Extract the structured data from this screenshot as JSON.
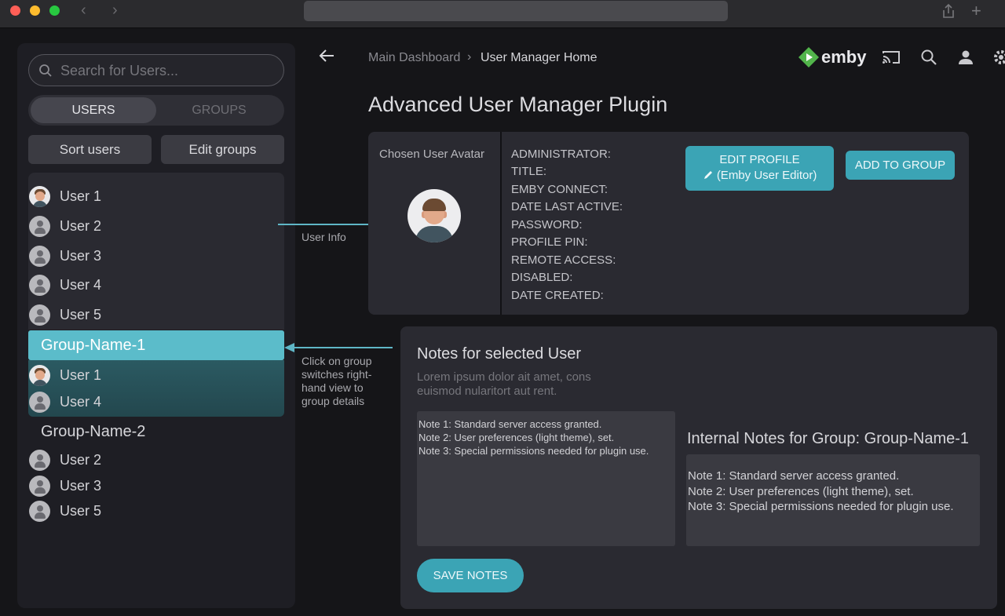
{
  "sidebar": {
    "search_placeholder": "Search for Users...",
    "tabs": [
      {
        "label": "USERS",
        "active": true
      },
      {
        "label": "GROUPS",
        "active": false
      }
    ],
    "sort_label": "Sort users",
    "edit_groups_label": "Edit groups",
    "users": [
      {
        "label": "User 1",
        "avatar": "photo"
      },
      {
        "label": "User 2",
        "avatar": "generic"
      },
      {
        "label": "User 3",
        "avatar": "generic"
      },
      {
        "label": "User 4",
        "avatar": "generic"
      },
      {
        "label": "User 5",
        "avatar": "generic"
      }
    ],
    "groups": [
      {
        "name": "Group-Name-1",
        "selected": true,
        "members": [
          {
            "label": "User 1",
            "avatar": "photo"
          },
          {
            "label": "User 4",
            "avatar": "generic"
          }
        ]
      },
      {
        "name": "Group-Name-2",
        "selected": false,
        "members": [
          {
            "label": "User 2",
            "avatar": "generic"
          },
          {
            "label": "User 3",
            "avatar": "generic"
          },
          {
            "label": "User 5",
            "avatar": "generic"
          }
        ]
      }
    ]
  },
  "annotations": {
    "user_info": "User Info",
    "group_click": [
      "Click on group",
      "switches right-",
      "hand view to",
      "group details"
    ]
  },
  "header": {
    "breadcrumb": [
      "Main Dashboard",
      "User Manager Home"
    ],
    "breadcrumb_sep": "›",
    "brand": "emby",
    "icons": [
      "back-arrow-icon",
      "cast-icon",
      "search-icon",
      "user-icon",
      "gear-icon"
    ]
  },
  "page_title": "Advanced User Manager Plugin",
  "user_card": {
    "avatar_label": "Chosen User Avatar",
    "fields": [
      "ADMINISTRATOR:",
      "TITLE:",
      "EMBY CONNECT:",
      "DATE LAST ACTIVE:",
      "PASSWORD:",
      "PROFILE PIN:",
      "REMOTE ACCESS:",
      "DISABLED:",
      "DATE CREATED:"
    ],
    "edit_profile_label": "EDIT PROFILE",
    "edit_profile_sub": "(Emby User Editor)",
    "add_to_group_label": "ADD TO GROUP"
  },
  "notes": {
    "title": "Notes for selected User",
    "lorem": "Lorem ipsum dolor ait amet, cons euismod nularitort aut rent.",
    "user_notes": [
      "Note 1: Standard server access granted.",
      "Note 2: User preferences (light theme), set.",
      "Note 3: Special permissions needed for plugin use."
    ],
    "group_title": "Internal Notes for Group: Group-Name-1",
    "group_notes": [
      "Note 1: Standard server access granted.",
      "Note 2: User preferences (light theme), set.",
      "Note 3: Special permissions needed for plugin use."
    ],
    "save_label": "SAVE NOTES"
  },
  "colors": {
    "accent": "#3ba4b5",
    "group_highlight": "#5bbcca",
    "background": "#151518",
    "panel": "#2a2a31"
  }
}
